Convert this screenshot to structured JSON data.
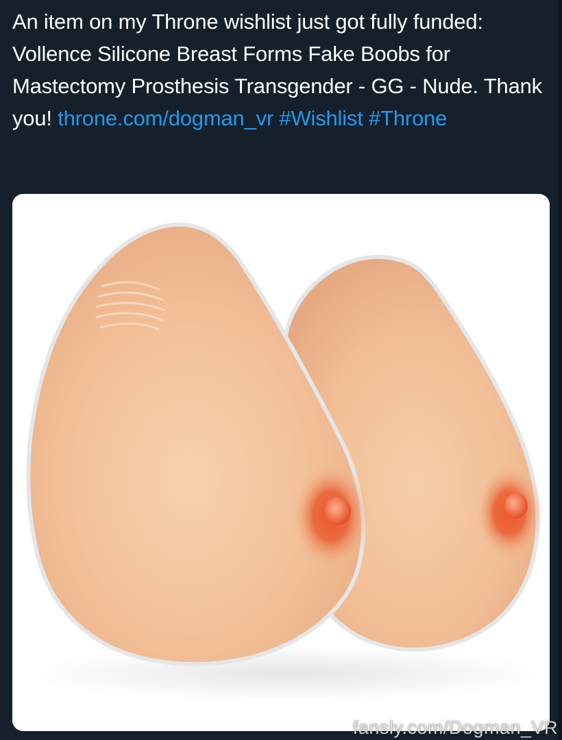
{
  "tweet": {
    "body_text": "An item on my Throne wishlist just got fully funded: Vollence Silicone Breast Forms Fake Boobs for Mastectomy Prosthesis Transgender - GG - Nude. Thank you!",
    "link": "throne.com/dogman_vr",
    "hashtags": [
      "#Wishlist",
      "#Throne"
    ]
  },
  "media": {
    "subject": "product-photo-silicone-breast-forms",
    "background_color": "#ffffff",
    "skin_color": "#f4c39b",
    "areola_color": "#e8572f"
  },
  "watermark": {
    "text": "fansly.com/Dogman_VR"
  },
  "colors": {
    "background": "#15202b",
    "text": "#ffffff",
    "link": "#1d9bf0"
  }
}
